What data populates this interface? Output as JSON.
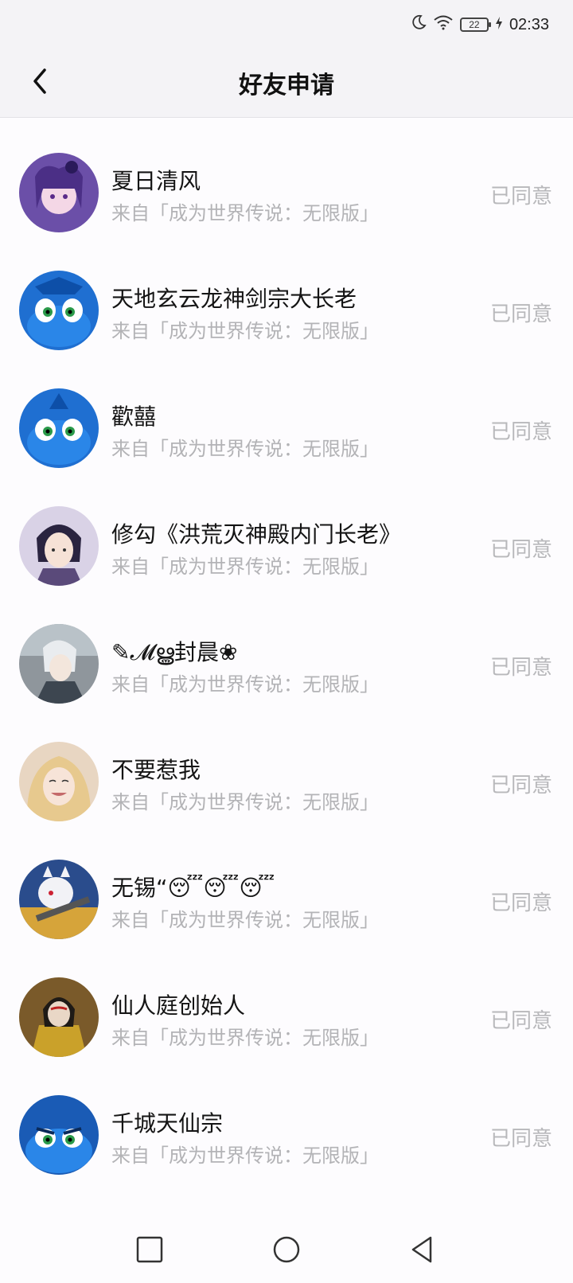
{
  "status_bar": {
    "battery_level": "22",
    "time": "02:33"
  },
  "header": {
    "title": "好友申请"
  },
  "requests": [
    {
      "name": "夏日清风",
      "source": "来自「成为世界传说：无限版」",
      "status": "已同意"
    },
    {
      "name": "天地玄云龙神剑宗大长老",
      "source": "来自「成为世界传说：无限版」",
      "status": "已同意"
    },
    {
      "name": "歡囍",
      "source": "来自「成为世界传说：无限版」",
      "status": "已同意"
    },
    {
      "name": "修勾《洪荒灭神殿内门长老》",
      "source": "来自「成为世界传说：无限版」",
      "status": "已同意"
    },
    {
      "name": "✎𝓜ൠ封晨❀",
      "source": "来自「成为世界传说：无限版」",
      "status": "已同意"
    },
    {
      "name": "不要惹我",
      "source": "来自「成为世界传说：无限版」",
      "status": "已同意"
    },
    {
      "name": "无锡“😴😴😴",
      "source": "来自「成为世界传说：无限版」",
      "status": "已同意"
    },
    {
      "name": "仙人庭创始人",
      "source": "来自「成为世界传说：无限版」",
      "status": "已同意"
    },
    {
      "name": "千城天仙宗",
      "source": "来自「成为世界传说：无限版」",
      "status": "已同意"
    }
  ],
  "colors": {
    "avatar_1": "#6b4fa8",
    "avatar_2": "#1f6fd1",
    "avatar_3": "#1f6fd1",
    "avatar_4": "#d9d2e6",
    "avatar_5": "#8f969c",
    "avatar_6": "#e8d6c2",
    "avatar_7": "#2a4c8c",
    "avatar_8": "#caa12a",
    "avatar_9": "#1a5bb5"
  }
}
